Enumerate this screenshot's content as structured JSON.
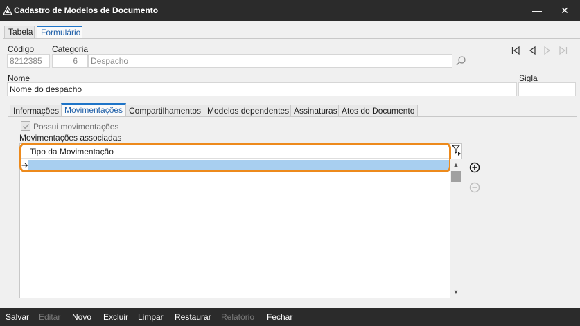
{
  "window": {
    "title": "Cadastro de Modelos de Documento",
    "minimize_glyph": "—",
    "close_glyph": "✕"
  },
  "top_tabs": [
    {
      "label": "Tabela",
      "active": false
    },
    {
      "label": "Formulário",
      "active": true
    }
  ],
  "form": {
    "codigo_label": "Código",
    "codigo_value": "8212385",
    "categoria_label": "Categoria",
    "categoria_code": "6",
    "categoria_name": "Despacho",
    "nome_label": "Nome",
    "nome_value": "Nome do despacho",
    "sigla_label": "Sigla",
    "sigla_value": ""
  },
  "inner_tabs": [
    {
      "label": "Informações",
      "active": false
    },
    {
      "label": "Movimentações",
      "active": true
    },
    {
      "label": "Compartilhamentos",
      "active": false
    },
    {
      "label": "Modelos dependentes",
      "active": false
    },
    {
      "label": "Assinaturas",
      "active": false
    },
    {
      "label": "Atos do Documento",
      "active": false
    }
  ],
  "movimentacoes": {
    "checkbox_label": "Possui movimentações",
    "checkbox_checked": true,
    "list_label": "Movimentações associadas",
    "column_header": "Tipo da Movimentação",
    "rows": [
      ""
    ]
  },
  "icons": {
    "app": "app-logo-icon",
    "search": "search-icon",
    "first": "first-record-icon",
    "prev": "previous-record-icon",
    "next": "next-record-icon",
    "last": "last-record-icon",
    "filter": "filter-icon",
    "add": "add-circle-icon",
    "remove": "remove-circle-icon",
    "row_indicator": "current-row-arrow-icon"
  },
  "colors": {
    "accent": "#1e74c8",
    "highlight": "#ed8a1c",
    "selected_row": "#a8cff0",
    "bar": "#2b2b2b"
  },
  "toolbar": [
    {
      "label": "Salvar",
      "enabled": true
    },
    {
      "label": "Editar",
      "enabled": false
    },
    {
      "label": "Novo",
      "enabled": true
    },
    {
      "label": "Excluir",
      "enabled": true
    },
    {
      "label": "Limpar",
      "enabled": true
    },
    {
      "label": "Restaurar",
      "enabled": true
    },
    {
      "label": "Relatório",
      "enabled": false
    },
    {
      "label": "Fechar",
      "enabled": true
    }
  ]
}
